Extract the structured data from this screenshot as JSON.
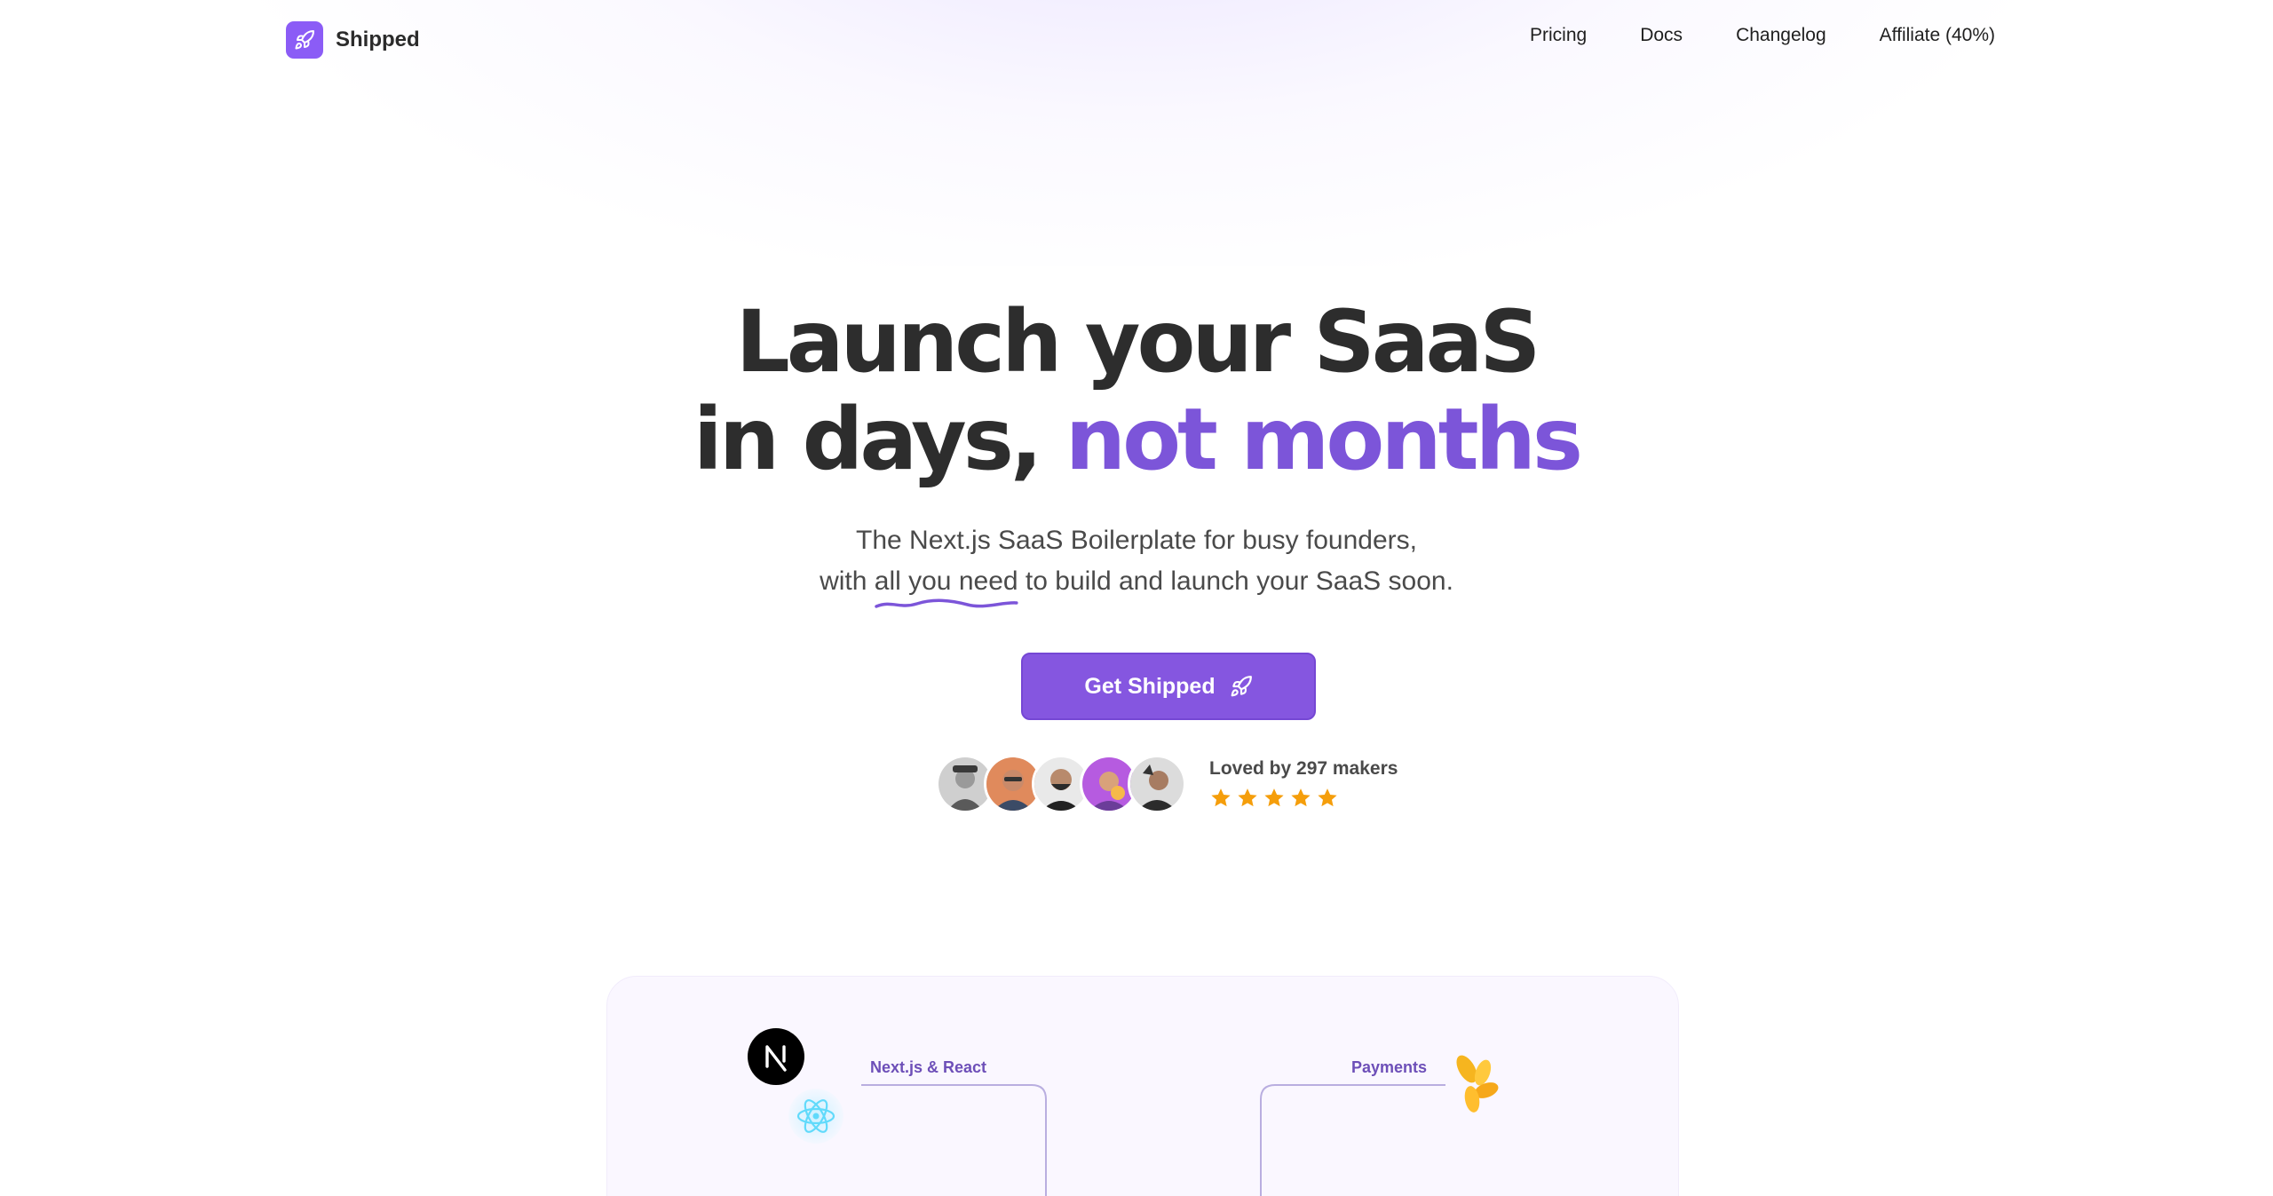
{
  "brand": {
    "name": "Shipped",
    "logo_icon": "rocket-icon",
    "color": "#8b5cf6"
  },
  "nav": {
    "links": [
      {
        "label": "Pricing"
      },
      {
        "label": "Docs"
      },
      {
        "label": "Changelog"
      },
      {
        "label": "Affiliate (40%)"
      }
    ]
  },
  "hero": {
    "title_line1": "Launch your SaaS",
    "title_line2_plain": "in days,",
    "title_line2_accent": "not months",
    "accent_color": "#7c55d9",
    "subtitle_line1": "The Next.js SaaS Boilerplate for busy founders,",
    "subtitle_line2_before": "with",
    "subtitle_line2_underlined": "all you need",
    "subtitle_line2_after": "to build and launch your SaaS soon."
  },
  "cta": {
    "label": "Get Shipped",
    "icon": "rocket-icon",
    "color": "#8556e0"
  },
  "social_proof": {
    "text": "Loved by 297 makers",
    "rating": 5,
    "star_color": "#f59e0b",
    "avatar_count": 5
  },
  "features": {
    "items": [
      {
        "label": "Next.js & React",
        "icons": [
          "nextjs-icon",
          "react-icon"
        ]
      },
      {
        "label": "Payments",
        "icons": [
          "lemon-squeezy-icon"
        ]
      }
    ]
  }
}
